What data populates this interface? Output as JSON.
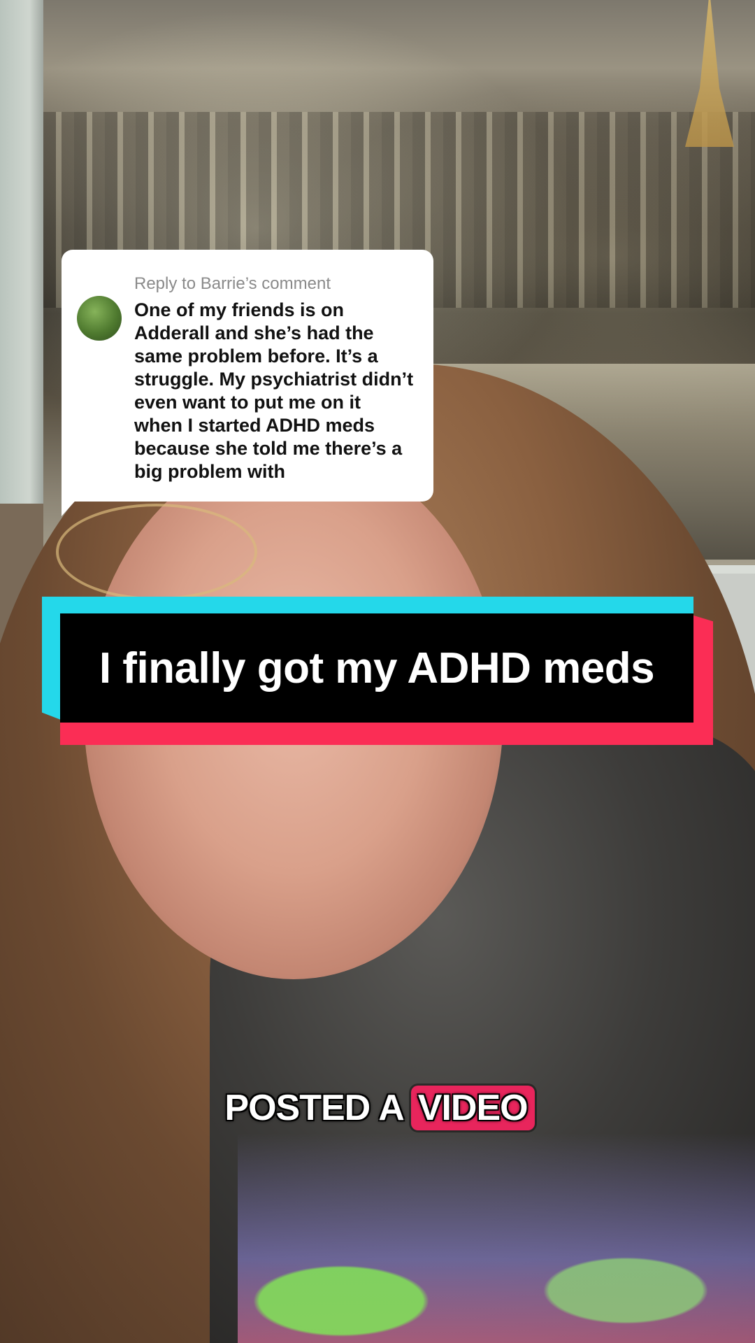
{
  "reply": {
    "header": "Reply to Barrie’s comment",
    "body": "One of my friends is on Adderall and she’s had the same problem before. It’s a struggle. My psychiatrist didn’t even want to put me on it when I started ADHD meds because she told me there’s a big problem with"
  },
  "banner": {
    "title": "I finally got my ADHD meds"
  },
  "caption": {
    "words": [
      "POSTED",
      "A",
      "VIDEO"
    ],
    "highlight_color": "#e8255c"
  },
  "colors": {
    "banner_cyan": "#24d8ea",
    "banner_red": "#fb2d55",
    "banner_black": "#000000"
  }
}
